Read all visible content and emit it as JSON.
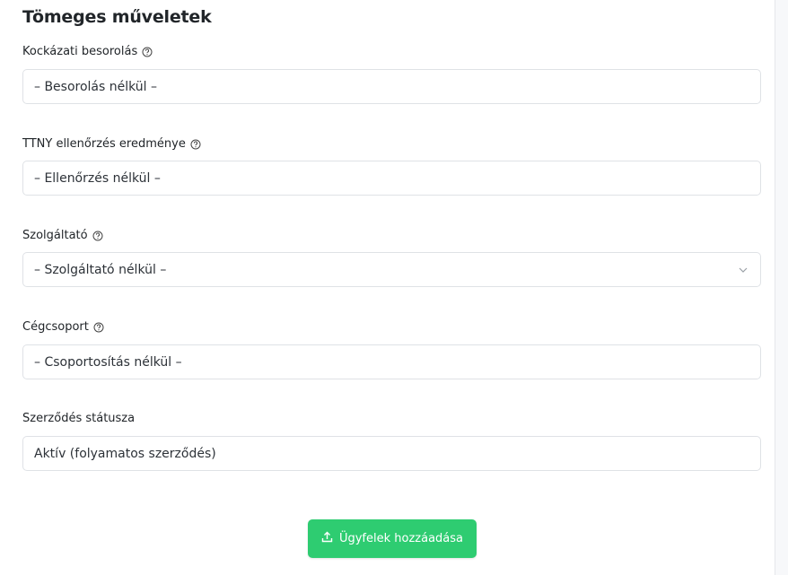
{
  "panel": {
    "title": "Tömeges műveletek"
  },
  "fields": {
    "risk": {
      "label": "Kockázati besorolás",
      "value": "– Besorolás nélkül –",
      "help_icon": "question-circle-icon"
    },
    "ttny": {
      "label": "TTNY ellenőrzés eredménye",
      "value": "– Ellenőrzés nélkül –",
      "help_icon": "question-circle-icon"
    },
    "provider": {
      "label": "Szolgáltató",
      "value": "– Szolgáltató nélkül –",
      "help_icon": "question-circle-icon",
      "dropdown_icon": "chevron-down-icon"
    },
    "group": {
      "label": "Cégcsoport",
      "value": "– Csoportosítás nélkül –",
      "help_icon": "question-circle-icon"
    },
    "contract": {
      "label": "Szerződés státusza",
      "value": "Aktív (folyamatos szerződés)"
    }
  },
  "actions": {
    "add_clients_label": "Ügyfelek hozzáadása",
    "add_clients_icon": "upload-icon",
    "button_color": "#2ecc71"
  }
}
